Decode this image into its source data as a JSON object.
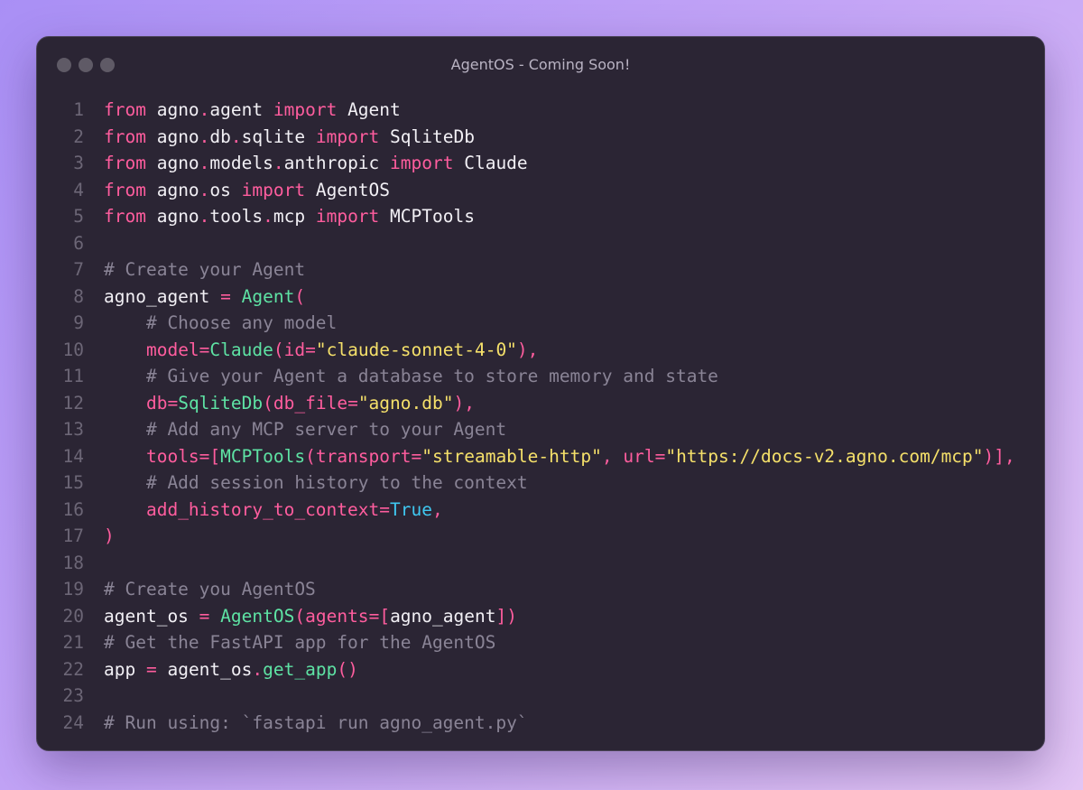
{
  "window": {
    "title": "AgentOS - Coming Soon!"
  },
  "colors": {
    "keyword": "#ff5d9e",
    "identifier": "#f2f0f5",
    "comment": "#8a8496",
    "function": "#5ee3a4",
    "string": "#f5e06a",
    "constant": "#3fc7f0",
    "line_number": "#6c6676",
    "editor_bg": "#2b2534"
  },
  "code": {
    "lines": [
      {
        "num": "1",
        "tokens": [
          [
            "kw",
            "from"
          ],
          [
            "id",
            " agno"
          ],
          [
            "dot",
            "."
          ],
          [
            "id",
            "agent "
          ],
          [
            "kw",
            "import"
          ],
          [
            "id",
            " Agent"
          ]
        ]
      },
      {
        "num": "2",
        "tokens": [
          [
            "kw",
            "from"
          ],
          [
            "id",
            " agno"
          ],
          [
            "dot",
            "."
          ],
          [
            "id",
            "db"
          ],
          [
            "dot",
            "."
          ],
          [
            "id",
            "sqlite "
          ],
          [
            "kw",
            "import"
          ],
          [
            "id",
            " SqliteDb"
          ]
        ]
      },
      {
        "num": "3",
        "tokens": [
          [
            "kw",
            "from"
          ],
          [
            "id",
            " agno"
          ],
          [
            "dot",
            "."
          ],
          [
            "id",
            "models"
          ],
          [
            "dot",
            "."
          ],
          [
            "id",
            "anthropic "
          ],
          [
            "kw",
            "import"
          ],
          [
            "id",
            " Claude"
          ]
        ]
      },
      {
        "num": "4",
        "tokens": [
          [
            "kw",
            "from"
          ],
          [
            "id",
            " agno"
          ],
          [
            "dot",
            "."
          ],
          [
            "id",
            "os "
          ],
          [
            "kw",
            "import"
          ],
          [
            "id",
            " AgentOS"
          ]
        ]
      },
      {
        "num": "5",
        "tokens": [
          [
            "kw",
            "from"
          ],
          [
            "id",
            " agno"
          ],
          [
            "dot",
            "."
          ],
          [
            "id",
            "tools"
          ],
          [
            "dot",
            "."
          ],
          [
            "id",
            "mcp "
          ],
          [
            "kw",
            "import"
          ],
          [
            "id",
            " MCPTools"
          ]
        ]
      },
      {
        "num": "6",
        "tokens": []
      },
      {
        "num": "7",
        "tokens": [
          [
            "cm",
            "# Create your Agent"
          ]
        ]
      },
      {
        "num": "8",
        "tokens": [
          [
            "id",
            "agno_agent "
          ],
          [
            "op",
            "="
          ],
          [
            "id",
            " "
          ],
          [
            "fn",
            "Agent"
          ],
          [
            "punc",
            "("
          ]
        ]
      },
      {
        "num": "9",
        "tokens": [
          [
            "cm",
            "    # Choose any model"
          ]
        ]
      },
      {
        "num": "10",
        "tokens": [
          [
            "id",
            "    "
          ],
          [
            "param",
            "model"
          ],
          [
            "op",
            "="
          ],
          [
            "fn",
            "Claude"
          ],
          [
            "punc",
            "("
          ],
          [
            "param",
            "id"
          ],
          [
            "op",
            "="
          ],
          [
            "str",
            "\"claude-sonnet-4-0\""
          ],
          [
            "punc",
            "),"
          ]
        ]
      },
      {
        "num": "11",
        "tokens": [
          [
            "cm",
            "    # Give your Agent a database to store memory and state"
          ]
        ]
      },
      {
        "num": "12",
        "tokens": [
          [
            "id",
            "    "
          ],
          [
            "param",
            "db"
          ],
          [
            "op",
            "="
          ],
          [
            "fn",
            "SqliteDb"
          ],
          [
            "punc",
            "("
          ],
          [
            "param",
            "db_file"
          ],
          [
            "op",
            "="
          ],
          [
            "str",
            "\"agno.db\""
          ],
          [
            "punc",
            "),"
          ]
        ]
      },
      {
        "num": "13",
        "tokens": [
          [
            "cm",
            "    # Add any MCP server to your Agent"
          ]
        ]
      },
      {
        "num": "14",
        "tokens": [
          [
            "id",
            "    "
          ],
          [
            "param",
            "tools"
          ],
          [
            "op",
            "="
          ],
          [
            "punc",
            "["
          ],
          [
            "fn",
            "MCPTools"
          ],
          [
            "punc",
            "("
          ],
          [
            "param",
            "transport"
          ],
          [
            "op",
            "="
          ],
          [
            "str",
            "\"streamable-http\""
          ],
          [
            "punc",
            ", "
          ],
          [
            "param",
            "url"
          ],
          [
            "op",
            "="
          ],
          [
            "str",
            "\"https://docs-v2.agno.com/mcp\""
          ],
          [
            "punc",
            ")],"
          ]
        ]
      },
      {
        "num": "15",
        "tokens": [
          [
            "cm",
            "    # Add session history to the context"
          ]
        ]
      },
      {
        "num": "16",
        "tokens": [
          [
            "id",
            "    "
          ],
          [
            "param",
            "add_history_to_context"
          ],
          [
            "op",
            "="
          ],
          [
            "const",
            "True"
          ],
          [
            "punc",
            ","
          ]
        ]
      },
      {
        "num": "17",
        "tokens": [
          [
            "punc",
            ")"
          ]
        ]
      },
      {
        "num": "18",
        "tokens": []
      },
      {
        "num": "19",
        "tokens": [
          [
            "cm",
            "# Create you AgentOS"
          ]
        ]
      },
      {
        "num": "20",
        "tokens": [
          [
            "id",
            "agent_os "
          ],
          [
            "op",
            "="
          ],
          [
            "id",
            " "
          ],
          [
            "fn",
            "AgentOS"
          ],
          [
            "punc",
            "("
          ],
          [
            "param",
            "agents"
          ],
          [
            "op",
            "="
          ],
          [
            "punc",
            "["
          ],
          [
            "id",
            "agno_agent"
          ],
          [
            "punc",
            "])"
          ]
        ]
      },
      {
        "num": "21",
        "tokens": [
          [
            "cm",
            "# Get the FastAPI app for the AgentOS"
          ]
        ]
      },
      {
        "num": "22",
        "tokens": [
          [
            "id",
            "app "
          ],
          [
            "op",
            "="
          ],
          [
            "id",
            " agent_os"
          ],
          [
            "dot",
            "."
          ],
          [
            "fn",
            "get_app"
          ],
          [
            "punc",
            "()"
          ]
        ]
      },
      {
        "num": "23",
        "tokens": []
      },
      {
        "num": "24",
        "tokens": [
          [
            "cm",
            "# Run using: `fastapi run agno_agent.py`"
          ]
        ]
      }
    ]
  }
}
